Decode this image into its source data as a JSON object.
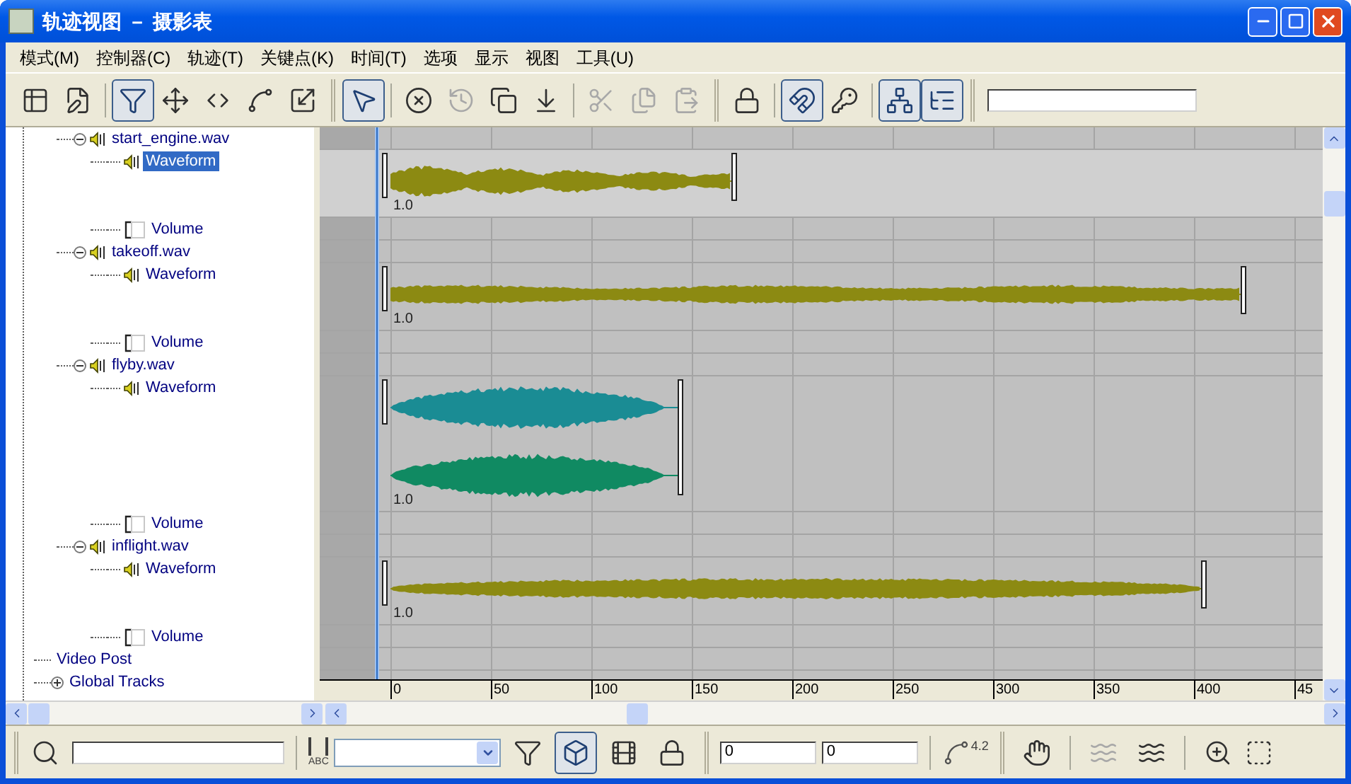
{
  "window": {
    "title": "轨迹视图 － 摄影表"
  },
  "menu": [
    "模式(M)",
    "控制器(C)",
    "轨迹(T)",
    "关键点(K)",
    "时间(T)",
    "选项",
    "显示",
    "视图",
    "工具(U)"
  ],
  "toolbar": [
    {
      "selected": false,
      "disabled": false
    },
    {
      "selected": false,
      "disabled": false
    },
    {
      "selected": true,
      "disabled": false
    },
    {
      "selected": false,
      "disabled": false
    },
    {
      "selected": false,
      "disabled": false
    },
    {
      "selected": false,
      "disabled": false
    },
    {
      "selected": false,
      "disabled": false
    },
    {
      "selected": true,
      "disabled": false
    },
    {
      "selected": false,
      "disabled": false
    },
    {
      "selected": false,
      "disabled": true
    },
    {
      "selected": false,
      "disabled": false
    },
    {
      "selected": false,
      "disabled": false
    },
    {
      "selected": false,
      "disabled": true
    },
    {
      "selected": false,
      "disabled": true
    },
    {
      "selected": false,
      "disabled": true
    },
    {
      "selected": false,
      "disabled": false
    },
    {
      "selected": true,
      "disabled": false
    },
    {
      "selected": false,
      "disabled": false
    },
    {
      "selected": true,
      "disabled": false
    },
    {
      "selected": true,
      "disabled": false
    }
  ],
  "tree": [
    {
      "kind": "group",
      "children": [
        {
          "kind": "sound",
          "label": "start_engine.wav",
          "expanded": true,
          "selected": false,
          "children": [
            {
              "kind": "waveform",
              "label": "Waveform",
              "selected": true,
              "level": 0.38,
              "scale": "1.0",
              "waves": [
                {
                  "color": "#8c8a12"
                }
              ]
            },
            {
              "kind": "volume",
              "label": "Volume",
              "selected": false
            }
          ]
        },
        {
          "kind": "sound",
          "label": "takeoff.wav",
          "expanded": true,
          "selected": false,
          "children": [
            {
              "kind": "waveform",
              "label": "Waveform",
              "selected": false,
              "level": 0.95,
              "scale": "1.0",
              "waves": [
                {
                  "color": "#8c8a12"
                }
              ]
            },
            {
              "kind": "volume",
              "label": "Volume",
              "selected": false
            }
          ]
        },
        {
          "kind": "sound",
          "label": "flyby.wav",
          "expanded": true,
          "selected": false,
          "children": [
            {
              "kind": "waveform",
              "label": "Waveform",
              "selected": false,
              "level": 0.32,
              "scale": "1.0",
              "waves": [
                {
                  "color": "#1a8c94"
                },
                {
                  "color": "#108a62"
                }
              ]
            },
            {
              "kind": "volume",
              "label": "Volume",
              "selected": false
            }
          ]
        },
        {
          "kind": "sound",
          "label": "inflight.wav",
          "expanded": true,
          "selected": false,
          "children": [
            {
              "kind": "waveform",
              "label": "Waveform",
              "selected": false,
              "level": 0.905,
              "scale": "1.0",
              "waves": [
                {
                  "color": "#8c8a12"
                }
              ]
            },
            {
              "kind": "volume",
              "label": "Volume",
              "selected": false
            }
          ]
        }
      ]
    },
    {
      "kind": "item",
      "label": "Video Post",
      "selected": false
    },
    {
      "kind": "item",
      "label": "Global Tracks",
      "expanded": false,
      "selected": false
    }
  ],
  "ruler": {
    "ticks": [
      "0",
      "50",
      "100",
      "150",
      "200",
      "250",
      "300",
      "350",
      "400",
      "45"
    ]
  },
  "bottom_toolbar": {
    "abc_label": "ABC",
    "range_start": "0",
    "range_end": "0",
    "curve_label": "4.2",
    "buttons": [
      {
        "selected": false,
        "disabled": false
      },
      {
        "selected": false,
        "disabled": false
      },
      {
        "selected": true,
        "disabled": false
      },
      {
        "selected": false,
        "disabled": false
      },
      {
        "selected": false,
        "disabled": false
      },
      {
        "selected": false,
        "disabled": false
      },
      {
        "selected": false,
        "disabled": true
      },
      {
        "selected": false,
        "disabled": false
      },
      {
        "selected": false,
        "disabled": false
      }
    ]
  }
}
